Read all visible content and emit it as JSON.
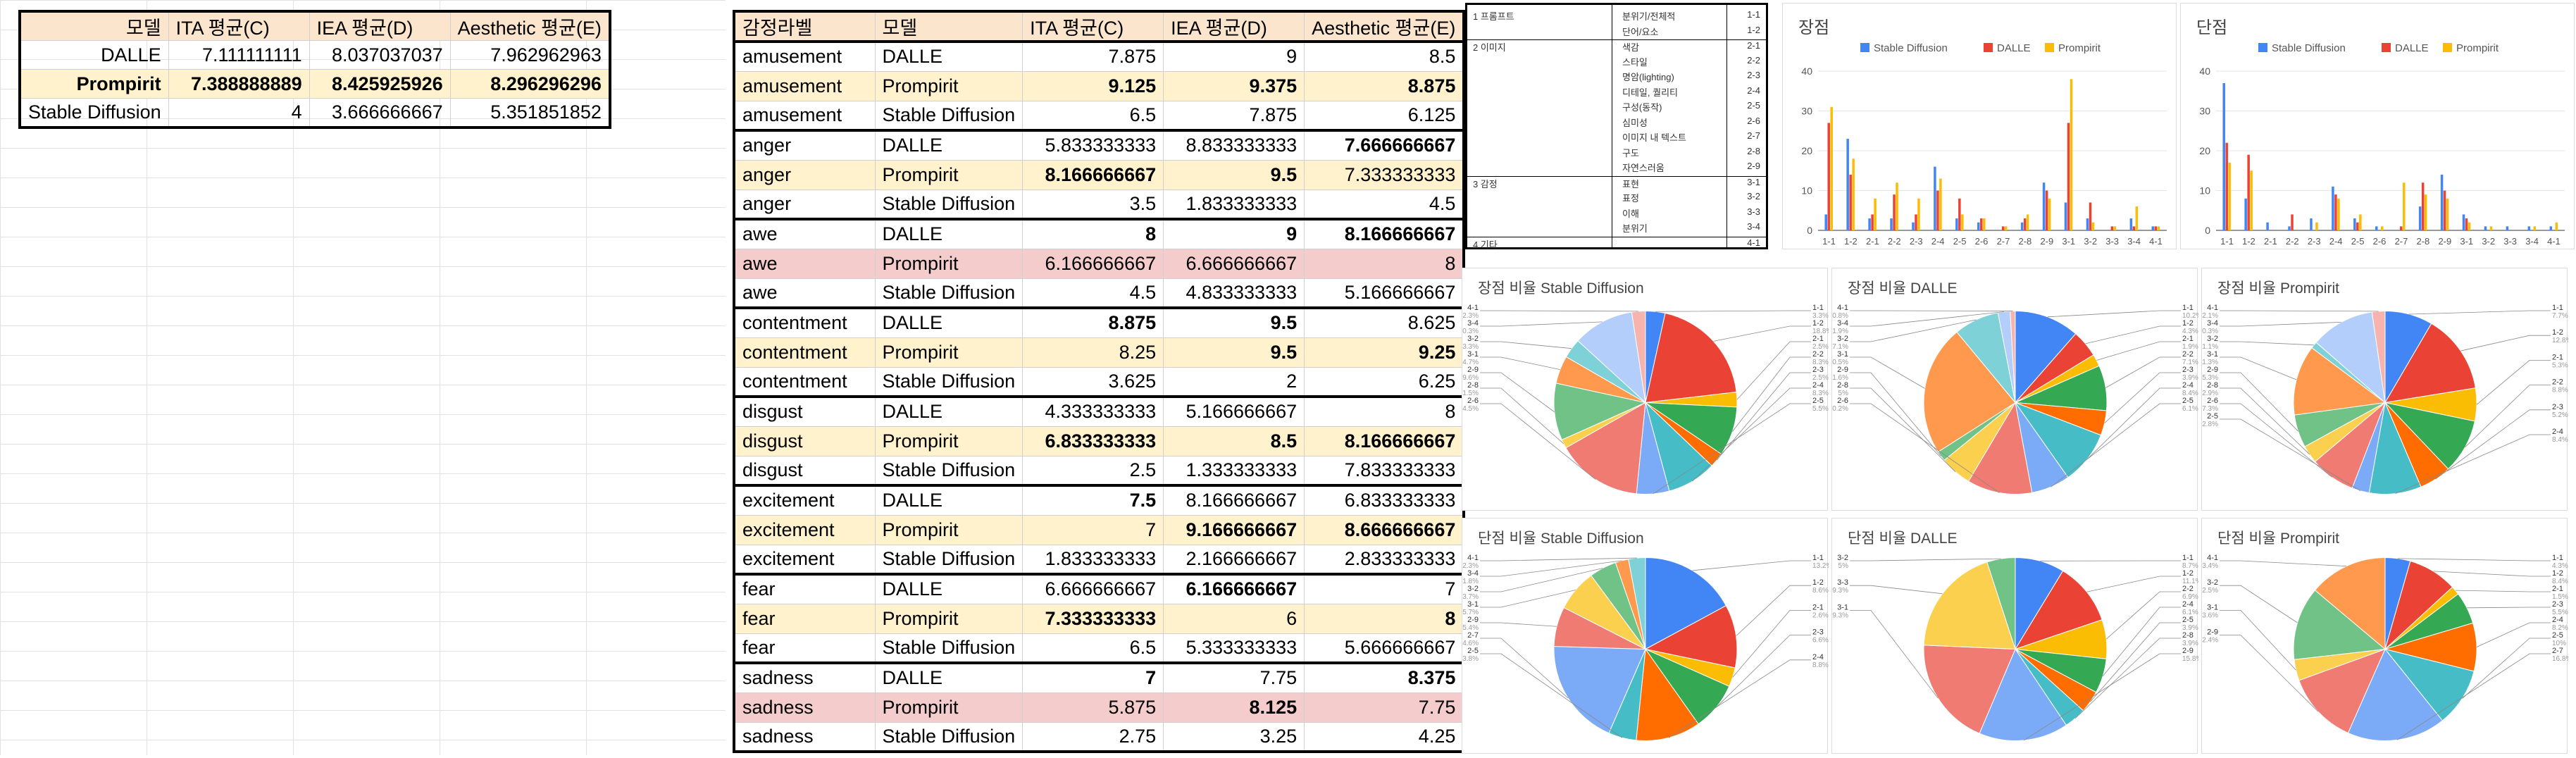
{
  "summary_table": {
    "headers": [
      "모델",
      "ITA 평균(C)",
      "IEA 평균(D)",
      "Aesthetic 평균(E)"
    ],
    "rows": [
      [
        "DALLE",
        "7.111111111",
        "8.037037037",
        "7.962962963"
      ],
      [
        "Prompirit",
        "7.388888889",
        "8.425925926",
        "8.296296296"
      ],
      [
        "Stable Diffusion",
        "4",
        "3.666666667",
        "5.351851852"
      ]
    ]
  },
  "emotion_table": {
    "headers": [
      "감정라벨",
      "모델",
      "ITA 평균(C)",
      "IEA 평균(D)",
      "Aesthetic 평균(E)"
    ],
    "rows": [
      {
        "c": [
          "amusement",
          "DALLE",
          "7.875",
          "9",
          "8.5"
        ],
        "s": "",
        "bold": []
      },
      {
        "c": [
          "amusement",
          "Prompirit",
          "9.125",
          "9.375",
          "8.875"
        ],
        "s": "yel",
        "bold": [
          2,
          3,
          4
        ]
      },
      {
        "c": [
          "amusement",
          "Stable Diffusion",
          "6.5",
          "7.875",
          "6.125"
        ],
        "s": "",
        "bold": []
      },
      {
        "c": [
          "anger",
          "DALLE",
          "5.833333333",
          "8.833333333",
          "7.666666667"
        ],
        "s": "",
        "bold": [
          4
        ]
      },
      {
        "c": [
          "anger",
          "Prompirit",
          "8.166666667",
          "9.5",
          "7.333333333"
        ],
        "s": "yel",
        "bold": [
          2,
          3
        ]
      },
      {
        "c": [
          "anger",
          "Stable Diffusion",
          "3.5",
          "1.833333333",
          "4.5"
        ],
        "s": "",
        "bold": []
      },
      {
        "c": [
          "awe",
          "DALLE",
          "8",
          "9",
          "8.166666667"
        ],
        "s": "",
        "bold": [
          2,
          3,
          4
        ]
      },
      {
        "c": [
          "awe",
          "Prompirit",
          "6.166666667",
          "6.666666667",
          "8"
        ],
        "s": "pink",
        "bold": []
      },
      {
        "c": [
          "awe",
          "Stable Diffusion",
          "4.5",
          "4.833333333",
          "5.166666667"
        ],
        "s": "",
        "bold": []
      },
      {
        "c": [
          "contentment",
          "DALLE",
          "8.875",
          "9.5",
          "8.625"
        ],
        "s": "",
        "bold": [
          2,
          3
        ]
      },
      {
        "c": [
          "contentment",
          "Prompirit",
          "8.25",
          "9.5",
          "9.25"
        ],
        "s": "yel",
        "bold": [
          3,
          4
        ]
      },
      {
        "c": [
          "contentment",
          "Stable Diffusion",
          "3.625",
          "2",
          "6.25"
        ],
        "s": "",
        "bold": []
      },
      {
        "c": [
          "disgust",
          "DALLE",
          "4.333333333",
          "5.166666667",
          "8"
        ],
        "s": "",
        "bold": []
      },
      {
        "c": [
          "disgust",
          "Prompirit",
          "6.833333333",
          "8.5",
          "8.166666667"
        ],
        "s": "yel",
        "bold": [
          2,
          3,
          4
        ]
      },
      {
        "c": [
          "disgust",
          "Stable Diffusion",
          "2.5",
          "1.333333333",
          "7.833333333"
        ],
        "s": "",
        "bold": []
      },
      {
        "c": [
          "excitement",
          "DALLE",
          "7.5",
          "8.166666667",
          "6.833333333"
        ],
        "s": "",
        "bold": [
          2
        ]
      },
      {
        "c": [
          "excitement",
          "Prompirit",
          "7",
          "9.166666667",
          "8.666666667"
        ],
        "s": "yel",
        "bold": [
          3,
          4
        ]
      },
      {
        "c": [
          "excitement",
          "Stable Diffusion",
          "1.833333333",
          "2.166666667",
          "2.833333333"
        ],
        "s": "",
        "bold": []
      },
      {
        "c": [
          "fear",
          "DALLE",
          "6.666666667",
          "6.166666667",
          "7"
        ],
        "s": "",
        "bold": [
          3
        ]
      },
      {
        "c": [
          "fear",
          "Prompirit",
          "7.333333333",
          "6",
          "8"
        ],
        "s": "yel",
        "bold": [
          2,
          4
        ]
      },
      {
        "c": [
          "fear",
          "Stable Diffusion",
          "6.5",
          "5.333333333",
          "5.666666667"
        ],
        "s": "",
        "bold": []
      },
      {
        "c": [
          "sadness",
          "DALLE",
          "7",
          "7.75",
          "8.375"
        ],
        "s": "",
        "bold": [
          2,
          4
        ]
      },
      {
        "c": [
          "sadness",
          "Prompirit",
          "5.875",
          "8.125",
          "7.75"
        ],
        "s": "pink",
        "bold": [
          3
        ]
      },
      {
        "c": [
          "sadness",
          "Stable Diffusion",
          "2.75",
          "3.25",
          "4.25"
        ],
        "s": "",
        "bold": []
      }
    ]
  },
  "category_table": [
    {
      "cat": "1 프롬프트",
      "sub": "분위기/전체적",
      "code": "1-1"
    },
    {
      "cat": "",
      "sub": "단어/요소",
      "code": "1-2"
    },
    {
      "cat": "2 이미지",
      "sub": "색감",
      "code": "2-1"
    },
    {
      "cat": "",
      "sub": "스타일",
      "code": "2-2"
    },
    {
      "cat": "",
      "sub": "명암(lighting)",
      "code": "2-3"
    },
    {
      "cat": "",
      "sub": "디테일, 퀄리티",
      "code": "2-4"
    },
    {
      "cat": "",
      "sub": "구성(동작)",
      "code": "2-5"
    },
    {
      "cat": "",
      "sub": "심미성",
      "code": "2-6"
    },
    {
      "cat": "",
      "sub": "이미지 내 텍스트",
      "code": "2-7"
    },
    {
      "cat": "",
      "sub": "구도",
      "code": "2-8"
    },
    {
      "cat": "",
      "sub": "자연스러움",
      "code": "2-9"
    },
    {
      "cat": "3 감정",
      "sub": "표현",
      "code": "3-1"
    },
    {
      "cat": "",
      "sub": "표정",
      "code": "3-2"
    },
    {
      "cat": "",
      "sub": "이해",
      "code": "3-3"
    },
    {
      "cat": "",
      "sub": "분위기",
      "code": "3-4"
    },
    {
      "cat": "4 기타",
      "sub": "",
      "code": "4-1"
    }
  ],
  "colors": {
    "sd": "#4285f4",
    "dalle": "#ea4335",
    "prompirit": "#fbbc04"
  },
  "pie_colors": [
    "#4285f4",
    "#ea4335",
    "#fbbc04",
    "#34a853",
    "#ff6d01",
    "#46bdc6",
    "#7baaf7",
    "#f07b72",
    "#fcd04f",
    "#71c287",
    "#ff994d",
    "#7ed1d7",
    "#b3cefb",
    "#f7b4ae",
    "#fde49b",
    "#aedcba"
  ],
  "chart_data": [
    {
      "type": "bar",
      "title": "장점",
      "categories": [
        "1-1",
        "1-2",
        "2-1",
        "2-2",
        "2-3",
        "2-4",
        "2-5",
        "2-6",
        "2-7",
        "2-8",
        "2-9",
        "3-1",
        "3-2",
        "3-3",
        "3-4",
        "4-1"
      ],
      "ylim": [
        0,
        40
      ],
      "yticks": [
        0,
        10,
        20,
        30,
        40
      ],
      "series": [
        {
          "name": "Stable Diffusion",
          "values": [
            4,
            23,
            3,
            3,
            2,
            16,
            3,
            2,
            0,
            2,
            12,
            7,
            3,
            0,
            3,
            1
          ]
        },
        {
          "name": "DALLE",
          "values": [
            27,
            14,
            4,
            9,
            4,
            10,
            8,
            3,
            1,
            3,
            10,
            27,
            7,
            1,
            1,
            1
          ]
        },
        {
          "name": "Prompirit",
          "values": [
            31,
            18,
            8,
            12,
            8,
            13,
            4,
            3,
            1,
            4,
            8,
            38,
            2,
            1,
            6,
            1
          ]
        }
      ]
    },
    {
      "type": "bar",
      "title": "단점",
      "categories": [
        "1-1",
        "1-2",
        "2-1",
        "2-2",
        "2-3",
        "2-4",
        "2-5",
        "2-6",
        "2-7",
        "2-8",
        "2-9",
        "3-1",
        "3-2",
        "3-3",
        "3-4",
        "4-1"
      ],
      "ylim": [
        0,
        40
      ],
      "yticks": [
        0,
        10,
        20,
        30,
        40
      ],
      "series": [
        {
          "name": "Stable Diffusion",
          "values": [
            37,
            8,
            2,
            1,
            3,
            11,
            3,
            1,
            0,
            6,
            14,
            4,
            1,
            1,
            1,
            1
          ]
        },
        {
          "name": "DALLE",
          "values": [
            22,
            19,
            0,
            4,
            0,
            9,
            2,
            0,
            1,
            12,
            10,
            3,
            0,
            0,
            0,
            0
          ]
        },
        {
          "name": "Prompirit",
          "values": [
            17,
            15,
            0,
            0,
            2,
            8,
            4,
            1,
            12,
            9,
            8,
            2,
            1,
            0,
            1,
            2
          ]
        }
      ]
    },
    {
      "type": "pie",
      "title": "장점 비율 Stable Diffusion",
      "labels": [
        "1-1",
        "1-2",
        "2-1",
        "2-2",
        "2-3",
        "2-4",
        "2-5",
        "2-6",
        "2-8",
        "2-9",
        "3-1",
        "3-2",
        "3-4",
        "4-1"
      ],
      "values": [
        3.3,
        18.8,
        2.5,
        8.3,
        2.5,
        8.3,
        5.5,
        14.5,
        1.5,
        9.6,
        4.7,
        3.3,
        10.3,
        2.3
      ]
    },
    {
      "type": "pie",
      "title": "장점 비율 DALLE",
      "labels": [
        "1-1",
        "1-2",
        "2-1",
        "2-2",
        "2-3",
        "2-4",
        "2-5",
        "2-6",
        "2-8",
        "2-9",
        "3-1",
        "3-2",
        "3-4",
        "4-1"
      ],
      "values": [
        10.2,
        4.3,
        1.9,
        7.1,
        3.9,
        8.4,
        6.1,
        10.2,
        5.0,
        1.6,
        20.5,
        7.1,
        1.9,
        0.8
      ]
    },
    {
      "type": "pie",
      "title": "장점 비율 Prompirit",
      "labels": [
        "1-1",
        "1-2",
        "2-1",
        "2-2",
        "2-3",
        "2-4",
        "2-5",
        "2-6",
        "2-8",
        "2-9",
        "3-1",
        "3-2",
        "3-4",
        "4-1"
      ],
      "values": [
        7.7,
        12.8,
        5.3,
        8.8,
        5.2,
        8.4,
        2.8,
        7.3,
        2.9,
        5.3,
        11.3,
        1.1,
        10.3,
        2.1
      ]
    },
    {
      "type": "pie",
      "title": "단점 비율 Stable Diffusion",
      "labels": [
        "1-1",
        "1-2",
        "2-1",
        "2-3",
        "2-4",
        "2-5",
        "2-7",
        "2-9",
        "3-1",
        "3-2",
        "3-4",
        "4-1"
      ],
      "values": [
        13.2,
        8.6,
        2.6,
        6.6,
        8.8,
        3.8,
        14.6,
        5.4,
        5.7,
        3.7,
        1.8,
        2.3
      ]
    },
    {
      "type": "pie",
      "title": "단점 비율 DALLE",
      "labels": [
        "1-1",
        "1-2",
        "2-2",
        "2-4",
        "2-5",
        "2-8",
        "2-9",
        "3-1",
        "3-3",
        "3-2"
      ],
      "values": [
        8.7,
        11.1,
        6.9,
        6.1,
        3.9,
        3.9,
        15.8,
        19.3,
        19.3,
        5.0
      ]
    },
    {
      "type": "pie",
      "title": "단점 비율 Prompirit",
      "labels": [
        "1-1",
        "1-2",
        "2-1",
        "2-3",
        "2-4",
        "2-5",
        "2-7",
        "2-9",
        "3-1",
        "3-2",
        "4-1"
      ],
      "values": [
        4.3,
        8.4,
        1.5,
        5.5,
        8.2,
        10.0,
        16.8,
        12.4,
        3.6,
        12.5,
        13.4
      ]
    }
  ]
}
